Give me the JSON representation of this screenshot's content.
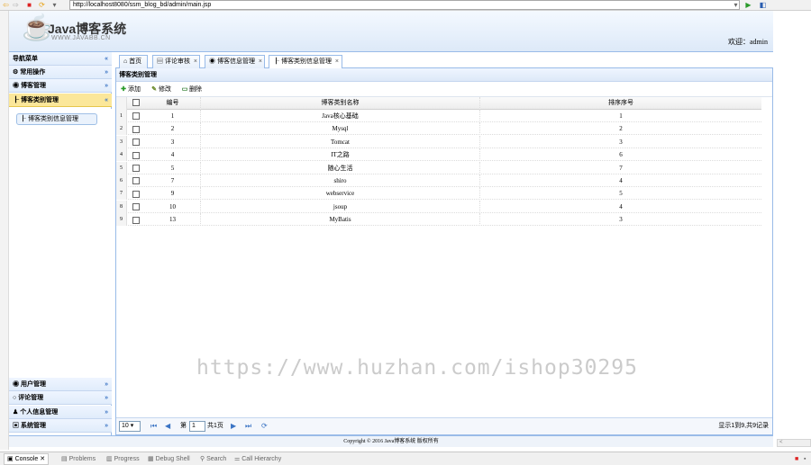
{
  "browser": {
    "url": "http://localhost8080/ssm_blog_bd/admin/main.jsp"
  },
  "header": {
    "logo_title": "Java博客系统",
    "logo_subtitle": "WWW.JAVABB.CN",
    "welcome": "欢迎：admin"
  },
  "nav": {
    "title": "导航菜单",
    "sections": [
      {
        "label": "常用操作"
      },
      {
        "label": "博客管理"
      },
      {
        "label": "博客类别管理"
      }
    ],
    "bottom_sections": [
      {
        "label": "用户管理"
      },
      {
        "label": "评论管理"
      },
      {
        "label": "个人信息管理"
      },
      {
        "label": "系统管理"
      }
    ],
    "item_label": "博客类别信息管理"
  },
  "tabs": [
    {
      "label": "首页"
    },
    {
      "label": "评论审核"
    },
    {
      "label": "博客信息管理"
    },
    {
      "label": "博客类别信息管理"
    }
  ],
  "panel": {
    "title": "博客类别管理",
    "toolbar": {
      "add": "添加",
      "edit": "修改",
      "delete": "删除"
    },
    "columns": [
      "编号",
      "博客类别名称",
      "排序序号"
    ],
    "rows": [
      {
        "n": "1",
        "id": "1",
        "name": "Java核心基础",
        "order": "1"
      },
      {
        "n": "2",
        "id": "2",
        "name": "Mysql",
        "order": "2"
      },
      {
        "n": "3",
        "id": "3",
        "name": "Tomcat",
        "order": "3"
      },
      {
        "n": "4",
        "id": "4",
        "name": "IT之路",
        "order": "6"
      },
      {
        "n": "5",
        "id": "5",
        "name": "随心生活",
        "order": "7"
      },
      {
        "n": "6",
        "id": "7",
        "name": "shiro",
        "order": "4"
      },
      {
        "n": "7",
        "id": "9",
        "name": "webservice",
        "order": "5"
      },
      {
        "n": "8",
        "id": "10",
        "name": "jsoup",
        "order": "4"
      },
      {
        "n": "9",
        "id": "13",
        "name": "MyBatis",
        "order": "3"
      }
    ],
    "pager": {
      "page_size": "10",
      "page_prefix": "第",
      "page_value": "1",
      "page_suffix": "共1页",
      "info": "显示1到9,共9记录"
    }
  },
  "footer": {
    "text": "Copyright © 2016 Java博客系统 版权所有"
  },
  "ide": {
    "tabs": [
      "Console",
      "Problems",
      "Progress",
      "Debug Shell",
      "Search",
      "Call Hierarchy"
    ]
  },
  "watermark": "https://www.huzhan.com/ishop30295"
}
